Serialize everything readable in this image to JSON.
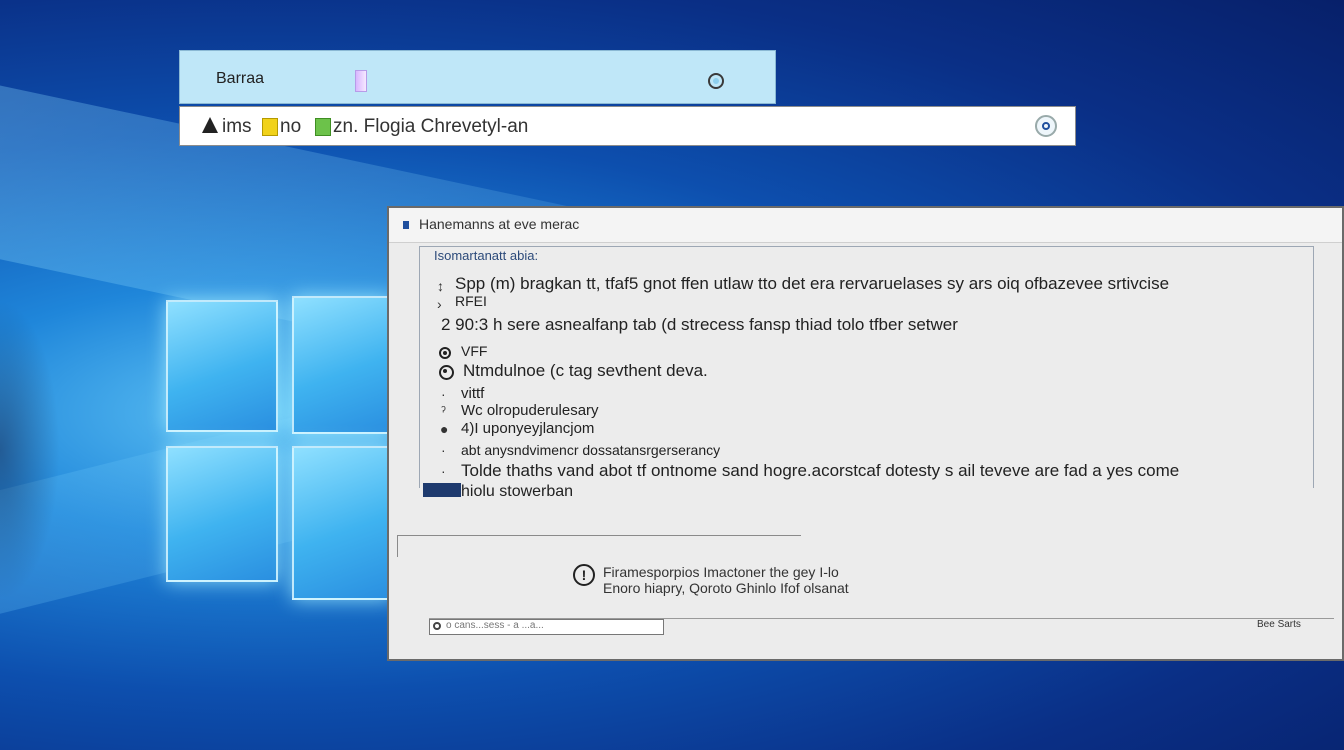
{
  "top_window": {
    "title": "Barraa"
  },
  "path_bar": {
    "segments": [
      "ims",
      "no",
      "zn. Flogia Chrevetyl-an"
    ]
  },
  "dialog": {
    "title": "Hanemanns at eve merac",
    "heading": "Isomartanatt abia:",
    "lines": [
      "Spp (m) bragkan tt, tfaf5 gnot ffen utlaw tto det era rervaruelases sy ars oiq ofbazeveе srtivcise",
      "RFEI",
      "2 90:3 h sere asnealfanp tab (d strecess fansp thiad tolo tfber setwer",
      "VFF",
      "Ntmdulnoe (c tag sevthent deva.",
      "vittf",
      "Wc olropuderulesary",
      "4)I uponyeyjlancjom",
      "abt anysndvimencr dossatansrgerserancy",
      "Tolde thaths vand abot tf ontnome sand hogre.acorstcaf dotesty s ail teveve are fad a yes come",
      "hiolu stowerban"
    ],
    "info_line1": "Firamesporpios Imactoner the gey I-lo",
    "info_line2": "Enoro hiapry, Qoroto Ghinlo Ifof olsanat",
    "bottom_field": "o cans...sess - a ...a...",
    "bottom_right": "Bee Sarts"
  }
}
